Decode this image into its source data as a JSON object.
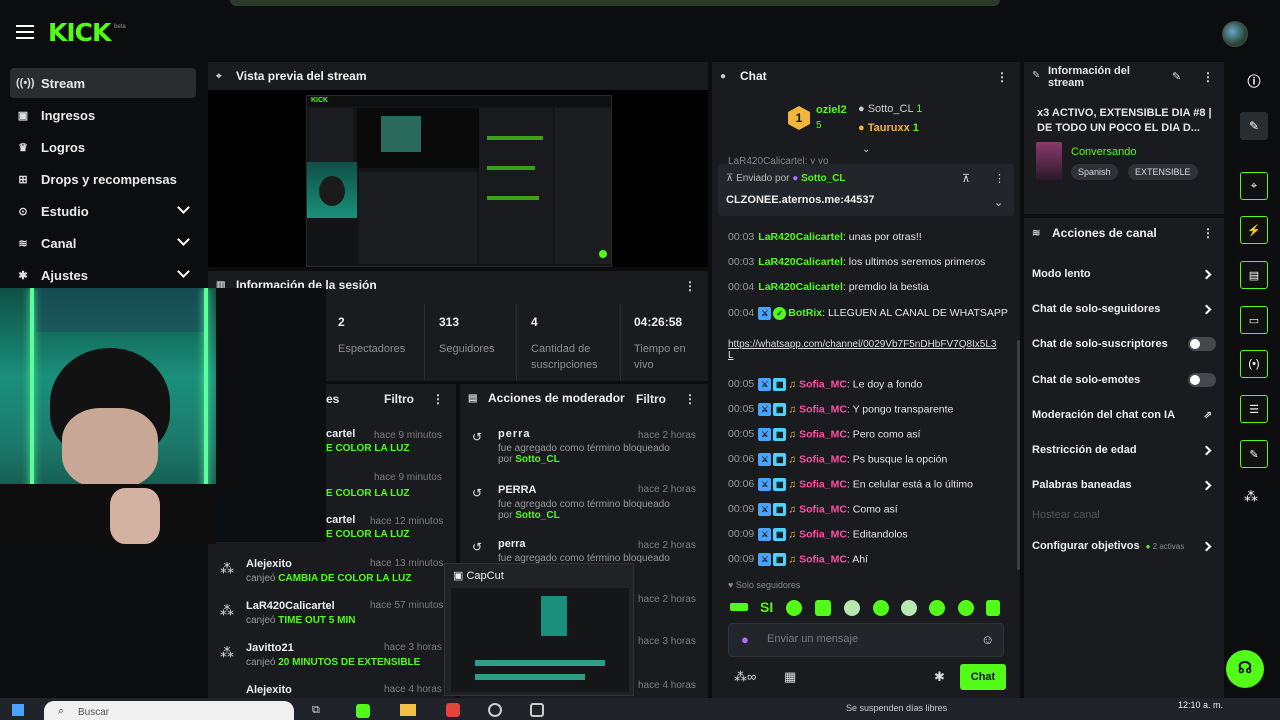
{
  "header": {
    "logo": "KICK",
    "logo_sup": "beta"
  },
  "sidebar": {
    "items": [
      {
        "label": "Stream",
        "icon": "broadcast-icon"
      },
      {
        "label": "Ingresos",
        "icon": "wallet-icon"
      },
      {
        "label": "Logros",
        "icon": "trophy-icon"
      },
      {
        "label": "Drops y recompensas",
        "icon": "gift-icon"
      },
      {
        "label": "Estudio",
        "icon": "studio-icon"
      },
      {
        "label": "Canal",
        "icon": "channel-icon"
      },
      {
        "label": "Ajustes",
        "icon": "gear-icon"
      }
    ]
  },
  "preview": {
    "title": "Vista previa del stream"
  },
  "session": {
    "title": "Información de la sesión",
    "stats": [
      {
        "value": "2",
        "label": "Espectadores"
      },
      {
        "value": "313",
        "label": "Seguidores"
      },
      {
        "value": "4",
        "label": "Cantidad de suscripciones"
      },
      {
        "value": "04:26:58",
        "label": "Tiempo en vivo"
      }
    ]
  },
  "rewards": {
    "title_fragment": "es",
    "filter": "Filtro",
    "rows": [
      {
        "name": "cartel",
        "time": "hace 9 minutos",
        "text": "E COLOR LA LUZ"
      },
      {
        "name": "",
        "time": "hace 9 minutos",
        "text": "E COLOR LA LUZ"
      },
      {
        "name": "cartel",
        "time": "hace 12 minutos",
        "text": "E COLOR LA LUZ"
      },
      {
        "name": "Alejexito",
        "time": "hace 13 minutos",
        "prefix": "canjeó",
        "text": "CAMBIA DE COLOR LA LUZ"
      },
      {
        "name": "LaR420Calicartel",
        "time": "hace 57 minutos",
        "prefix": "canjeó",
        "text": "TIME OUT 5 MIN"
      },
      {
        "name": "Javitto21",
        "time": "hace 3 horas",
        "prefix": "canjeó",
        "text": "20 MINUTOS DE EXTENSIBLE"
      },
      {
        "name": "Alejexito",
        "time": "hace 4 horas",
        "prefix": "",
        "text": ""
      }
    ]
  },
  "modactions": {
    "title": "Acciones de moderador",
    "filter": "Filtro",
    "rows": [
      {
        "term": "perra",
        "time": "hace 2 horas",
        "desc": "fue agregado como término bloqueado",
        "by_label": "por",
        "by": "Sotto_CL"
      },
      {
        "term": "PERRA",
        "time": "hace 2 horas",
        "desc": "fue agregado como término bloqueado",
        "by_label": "por",
        "by": "Sotto_CL"
      },
      {
        "term": "perra",
        "time": "hace 2 horas",
        "desc": "fue agregado como término bloqueado",
        "by_label": "",
        "by": ""
      }
    ],
    "extra_times": [
      "hace 2 horas",
      "hace 3 horas",
      "hace 4 horas"
    ]
  },
  "capcut": {
    "title": "CapCut"
  },
  "chat": {
    "title": "Chat",
    "top_gifters": [
      {
        "rank": "1",
        "name": "oziel2",
        "count": "5"
      },
      {
        "name": "Sotto_CL",
        "count": "1"
      },
      {
        "name": "Tauruxx",
        "count": "1"
      }
    ],
    "partial_line": "LaR420Calicartel: y yo",
    "pinned": {
      "sent_by": "Enviado por",
      "user": "Sotto_CL",
      "message": "CLZONEE.aternos.me:44537"
    },
    "messages": [
      {
        "time": "00:03",
        "user": "LaR420Calicartel",
        "text": "unas por otras!!",
        "color": "green"
      },
      {
        "time": "00:03",
        "user": "LaR420Calicartel",
        "text": "los ultimos seremos primeros",
        "color": "green"
      },
      {
        "time": "00:04",
        "user": "LaR420Calicartel",
        "text": "premdio la bestia",
        "color": "green"
      },
      {
        "time": "00:04",
        "user": "BotRix",
        "text": "LLEGUEN AL CANAL DE WHATSAPP",
        "color": "green",
        "link": "https://whatsapp.com/channel/0029Vb7F5nDHbFV7Q8Ix5L3L"
      },
      {
        "time": "00:05",
        "user": "Sofia_MC",
        "text": "Le doy a fondo",
        "color": "pink"
      },
      {
        "time": "00:05",
        "user": "Sofia_MC",
        "text": "Y pongo transparente",
        "color": "pink"
      },
      {
        "time": "00:05",
        "user": "Sofia_MC",
        "text": "Pero como así",
        "color": "pink"
      },
      {
        "time": "00:06",
        "user": "Sofia_MC",
        "text": "Ps busque la opción",
        "color": "pink"
      },
      {
        "time": "00:06",
        "user": "Sofia_MC",
        "text": "En celular está a lo último",
        "color": "pink"
      },
      {
        "time": "00:09",
        "user": "Sofia_MC",
        "text": "Como así",
        "color": "pink"
      },
      {
        "time": "00:09",
        "user": "Sofia_MC",
        "text": "Editandolos",
        "color": "pink"
      },
      {
        "time": "00:09",
        "user": "Sofia_MC",
        "text": "Ahí",
        "color": "pink"
      }
    ],
    "followers_only": "Solo seguidores",
    "emote_text": "SI",
    "input_placeholder": "Enviar un mensaje",
    "send_label": "Chat"
  },
  "stream_info": {
    "title": "Información del stream",
    "stream_title": "x3 ACTIVO, EXTENSIBLE DIA #8 | DE TODO UN POCO EL DIA D...",
    "category": "Conversando",
    "tags": [
      "Spanish",
      "EXTENSIBLE"
    ]
  },
  "channel_actions": {
    "title": "Acciones de canal",
    "rows": [
      {
        "label": "Modo lento",
        "control": "arrow"
      },
      {
        "label": "Chat de solo-seguidores",
        "control": "arrow"
      },
      {
        "label": "Chat de solo-suscriptores",
        "control": "toggle"
      },
      {
        "label": "Chat de solo-emotes",
        "control": "toggle"
      },
      {
        "label": "Moderación del chat con IA",
        "control": "external"
      },
      {
        "label": "Restricción de edad",
        "control": "arrow"
      },
      {
        "label": "Palabras baneadas",
        "control": "arrow"
      },
      {
        "label": "Hostear canal",
        "control": "disabled"
      },
      {
        "label": "Configurar objetivos",
        "control": "arrow",
        "extra": "2 activas"
      }
    ]
  },
  "right_rail": [
    "info-icon",
    "pencil-icon",
    "target-icon",
    "bolt-icon",
    "notepad-icon",
    "chat-icon",
    "broadcast-icon",
    "layout-icon",
    "wrench-icon",
    "share-icon",
    "headset-icon"
  ],
  "taskbar": {
    "search_placeholder": "Buscar",
    "notification": "Se suspenden días libres",
    "clock": "12:10 a. m."
  },
  "colors": {
    "accent": "#53fc18",
    "panel": "#191b1f",
    "background": "#0b0d0e",
    "pink": "#ff4fa3"
  }
}
